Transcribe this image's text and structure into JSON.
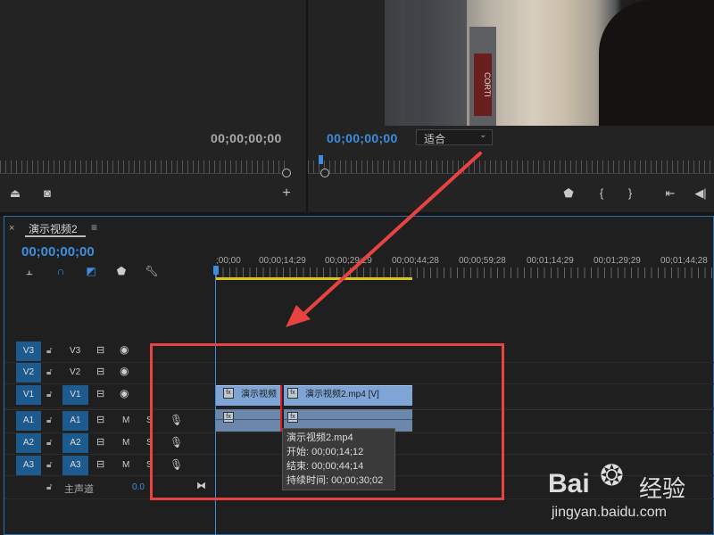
{
  "source_monitor": {
    "timecode": "00;00;00;00"
  },
  "program_monitor": {
    "timecode": "00;00;00;00",
    "zoom_select": "适合",
    "video_sign_text": "CORTI"
  },
  "timeline": {
    "tab_close": "×",
    "tab_title": "演示视频2",
    "tab_menu": "≡",
    "timecode": "00;00;00;00",
    "ruler_labels": [
      ";00;00",
      "00;00;14;29",
      "00;00;29;29",
      "00;00;44;28",
      "00;00;59;28",
      "00;01;14;29",
      "00;01;29;29",
      "00;01;44;28"
    ],
    "video_tracks": [
      {
        "target": "V3",
        "source": "",
        "name": "V3"
      },
      {
        "target": "V2",
        "source": "",
        "name": "V2"
      },
      {
        "target": "V1",
        "source": "V1",
        "name": ""
      }
    ],
    "audio_tracks": [
      {
        "target": "A1",
        "source": "A1",
        "m": "M",
        "s": "S"
      },
      {
        "target": "A2",
        "source": "A2",
        "m": "M",
        "s": "S"
      },
      {
        "target": "A3",
        "source": "A3",
        "m": "M",
        "s": "S"
      }
    ],
    "master_track": {
      "name": "主声道",
      "volume": "0.0"
    },
    "clips": {
      "clip1_label": "演示视频",
      "clip2_label": "演示视频2.mp4 [V]",
      "fx": "fx"
    },
    "tooltip": {
      "name": "演示视频2.mp4",
      "start": "开始: 00;00;14;12",
      "end": "结束: 00;00;44;14",
      "duration": "持续时间: 00;00;30;02"
    }
  },
  "watermark": {
    "brand": "Bai",
    "brand_suffix": "经验",
    "url": "jingyan.baidu.com"
  },
  "colors": {
    "accent_blue": "#3d8ee0",
    "annotation_red": "#e84343",
    "work_area_yellow": "#d8c51e"
  }
}
